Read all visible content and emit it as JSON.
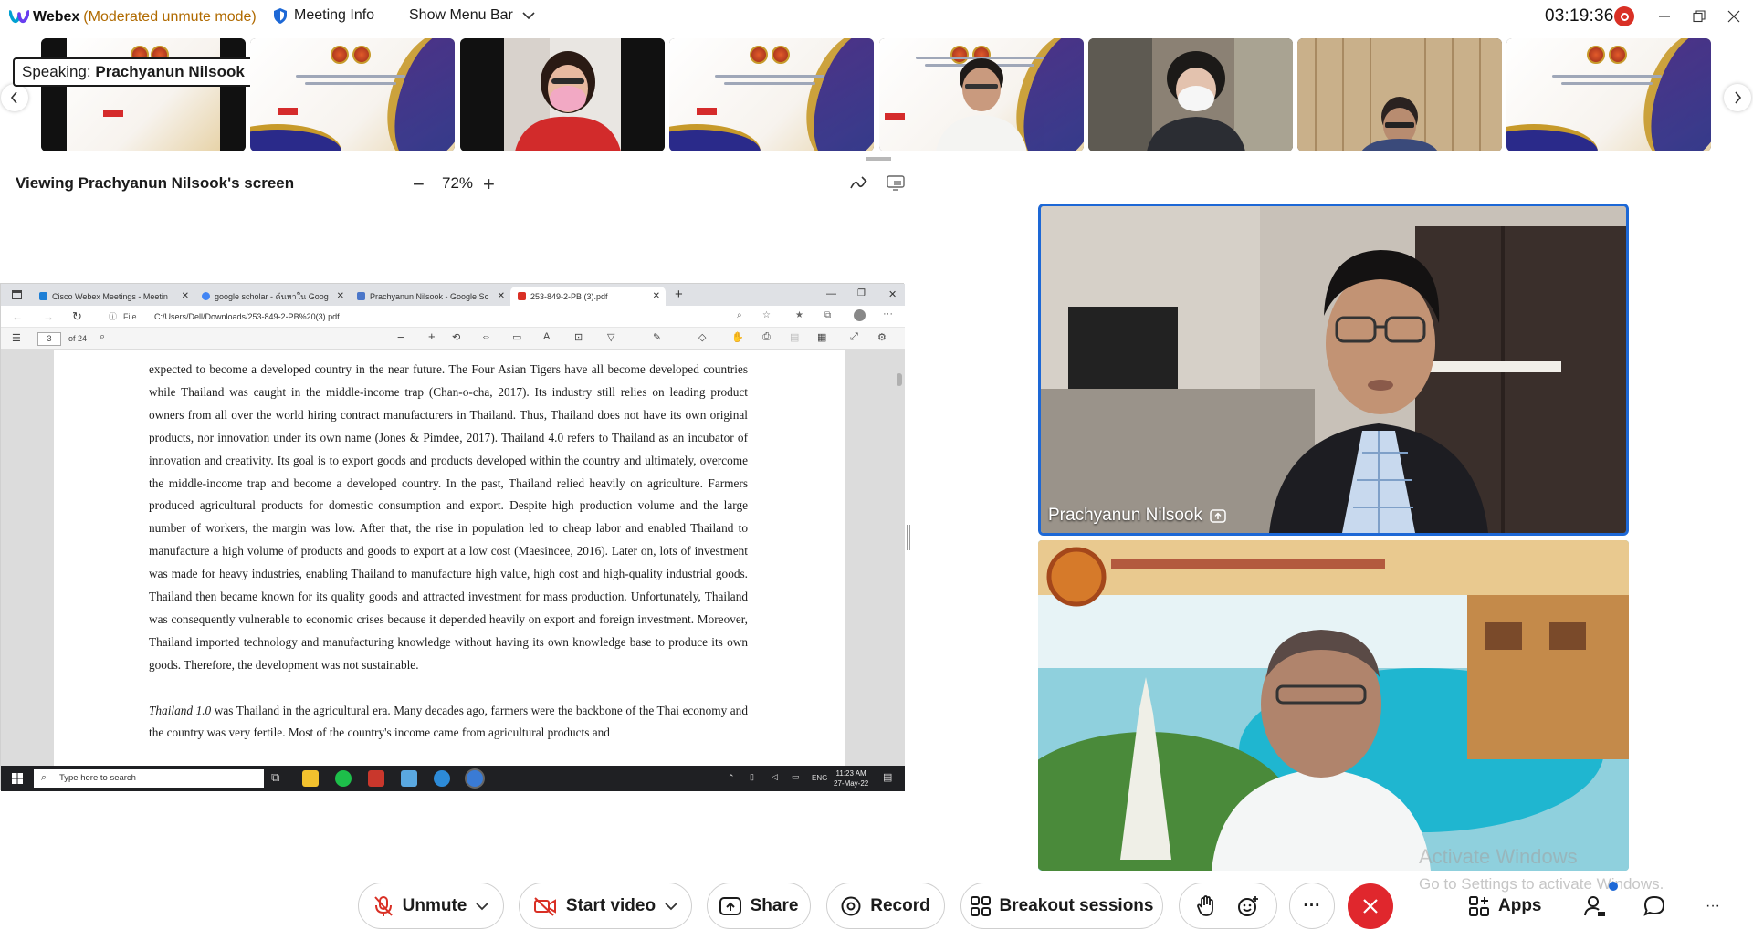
{
  "titlebar": {
    "app_name": "Webex",
    "mode": "(Moderated unmute mode)",
    "meeting_info": "Meeting Info",
    "show_menu_bar": "Show Menu Bar",
    "clock": "03:19:36"
  },
  "filmstrip": {
    "speaking_prefix": "Speaking:",
    "speaking_name": "Prachyanun Nilsook"
  },
  "viewing": {
    "title": "Viewing Prachyanun Nilsook's screen",
    "zoom_minus": "−",
    "zoom": "72%",
    "zoom_plus": "+"
  },
  "shared": {
    "tabs": [
      {
        "label": "Cisco Webex Meetings - Meetin",
        "color": "#1d7fd6"
      },
      {
        "label": "google scholar - ค้นหาใน Goog",
        "color": "#4285f4"
      },
      {
        "label": "Prachyanun Nilsook - Google Sc",
        "color": "#4a76c9"
      },
      {
        "label": "253-849-2-PB (3).pdf",
        "color": "#d93025"
      }
    ],
    "file_label": "File",
    "url": "C:/Users/Dell/Downloads/253-849-2-PB%20(3).pdf",
    "page": "3",
    "page_of": "of 24",
    "paragraph1": "expected to become a developed country in the near future. The Four Asian Tigers have all become developed countries while Thailand was caught in the middle-income trap (Chan-o-cha, 2017). Its industry still relies on leading product owners from all over the world hiring contract manufacturers in Thailand. Thus, Thailand does not have its own original products, nor innovation under its own name (Jones & Pimdee, 2017). Thailand 4.0 refers to Thailand as an incubator of innovation and creativity. Its goal is to export goods and products developed within the country and ultimately, overcome the middle-income trap and become a developed country. In the past, Thailand relied heavily on agriculture. Farmers produced agricultural products for domestic consumption and export. Despite high production volume and the large number of workers, the margin was low. After that, the rise in population led to cheap labor and enabled Thailand to manufacture a high volume of products and goods to export at a low cost (Maesincee, 2016). Later on, lots of investment was made for heavy industries, enabling Thailand to manufacture high value, high cost and high-quality industrial goods. Thailand then became known for its quality goods and attracted investment for mass production. Unfortunately, Thailand was consequently vulnerable to economic crises because it depended heavily on export and foreign investment. Moreover, Thailand imported technology and manufacturing knowledge without having its own knowledge base to produce its own goods. Therefore, the development was not sustainable.",
    "paragraph2_italic": "Thailand 1.0",
    "paragraph2": " was Thailand in the agricultural era. Many decades ago, farmers were the backbone of the Thai economy and the country was very fertile. Most of the country's income came from agricultural products and",
    "taskbar_search": "Type here to search",
    "tray_lang": "ENG",
    "tray_time": "11:23 AM",
    "tray_date": "27-May-22"
  },
  "videos": {
    "main_name": "Prachyanun Nilsook",
    "watermark_title": "Activate Windows",
    "watermark_sub": "Go to Settings to activate Windows."
  },
  "controls": {
    "unmute": "Unmute",
    "start_video": "Start video",
    "share": "Share",
    "record": "Record",
    "breakout": "Breakout sessions",
    "more": "···",
    "apps": "Apps"
  },
  "colors": {
    "accent": "#1d68d6",
    "end_call": "#e0272d",
    "mode_text": "#b06a00"
  }
}
